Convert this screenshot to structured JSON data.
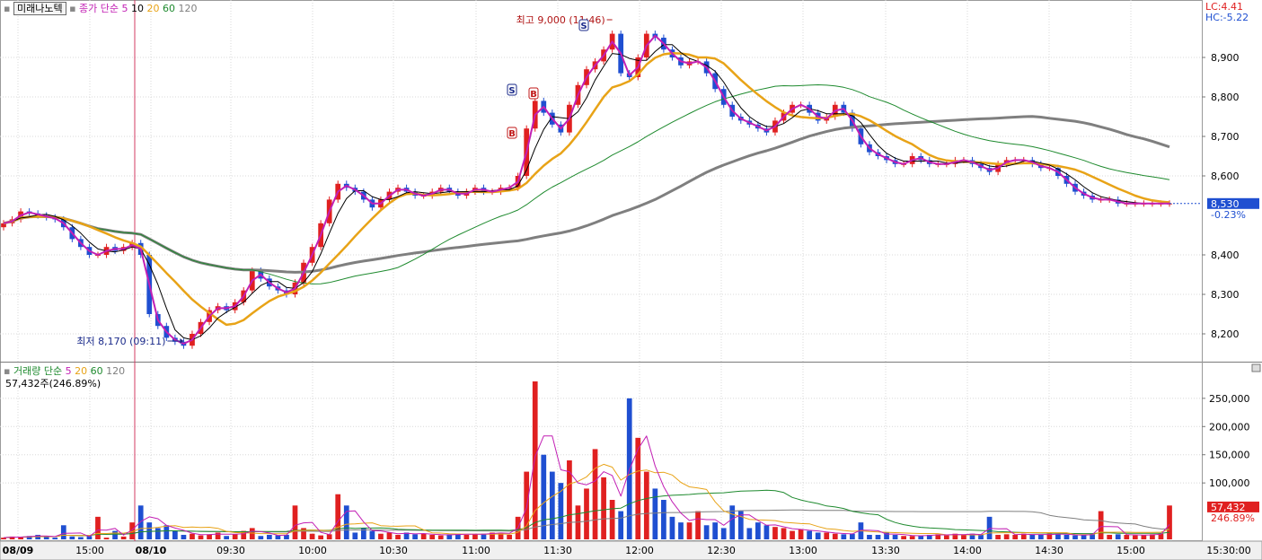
{
  "title": "미래나노텍",
  "price_legend": {
    "label": "종가 단순",
    "periods": [
      "5",
      "10",
      "20",
      "60",
      "120"
    ]
  },
  "lc_hc": {
    "lc": "LC:4.41",
    "hc": "HC:-5.22"
  },
  "current": {
    "price": "8,530",
    "change": "-0.23%"
  },
  "annotations": {
    "high": "최고 9,000 (11:46)",
    "low": "최저 8,170 (09:11)"
  },
  "volume_header": {
    "label": "거래량 단순",
    "periods": [
      "5",
      "20",
      "60",
      "120"
    ],
    "current": "57,432주(246.89%)"
  },
  "volume_current": {
    "value": "57,432",
    "pct": "246.89%"
  },
  "signals": [
    "S",
    "S",
    "B",
    "B"
  ],
  "colors": {
    "ma5": "#c21fb4",
    "ma10": "#000000",
    "ma20": "#e8a317",
    "ma60": "#1e8a2e",
    "ma120": "#7f7f7f",
    "up": "#e02020",
    "down": "#1f4fd1",
    "price_tag": "#1f4fd1",
    "vol_tag": "#e02020"
  },
  "chart_data": {
    "type": "candlestick",
    "price_axis": {
      "ticks": [
        "8,900",
        "8,800",
        "8,700",
        "8,600",
        "8,400",
        "8,300",
        "8,200"
      ],
      "ylim": [
        8150,
        9000
      ]
    },
    "volume_axis": {
      "ticks": [
        "250,000",
        "200,000",
        "150,000",
        "100,000"
      ],
      "ylim": [
        0,
        290000
      ]
    },
    "x_ticks": [
      "08/09",
      "15:00",
      "08/10",
      "09:30",
      "10:00",
      "10:30",
      "11:00",
      "11:30",
      "12:00",
      "12:30",
      "13:00",
      "13:30",
      "14:00",
      "14:30",
      "15:00",
      "15:30:00"
    ],
    "close": [
      8480,
      8490,
      8510,
      8505,
      8500,
      8495,
      8490,
      8470,
      8440,
      8420,
      8400,
      8400,
      8420,
      8410,
      8420,
      8430,
      8400,
      8250,
      8220,
      8190,
      8180,
      8170,
      8200,
      8230,
      8260,
      8270,
      8260,
      8280,
      8310,
      8360,
      8340,
      8320,
      8310,
      8300,
      8330,
      8380,
      8420,
      8480,
      8540,
      8580,
      8570,
      8560,
      8540,
      8520,
      8540,
      8560,
      8570,
      8560,
      8550,
      8550,
      8560,
      8570,
      8560,
      8550,
      8560,
      8570,
      8560,
      8560,
      8570,
      8570,
      8600,
      8720,
      8790,
      8760,
      8730,
      8710,
      8780,
      8830,
      8870,
      8890,
      8920,
      8960,
      8860,
      8850,
      8900,
      8960,
      8950,
      8920,
      8900,
      8880,
      8890,
      8890,
      8860,
      8820,
      8780,
      8750,
      8740,
      8730,
      8720,
      8710,
      8740,
      8760,
      8780,
      8780,
      8760,
      8740,
      8750,
      8780,
      8760,
      8720,
      8680,
      8660,
      8650,
      8640,
      8630,
      8630,
      8650,
      8640,
      8630,
      8630,
      8630,
      8640,
      8640,
      8630,
      8620,
      8610,
      8630,
      8640,
      8640,
      8640,
      8630,
      8620,
      8620,
      8600,
      8580,
      8560,
      8550,
      8540,
      8540,
      8540,
      8530,
      8530,
      8530,
      8530,
      8530,
      8530,
      8530
    ],
    "volume": [
      3000,
      5000,
      4000,
      6000,
      8000,
      4000,
      3000,
      25000,
      5000,
      4000,
      6000,
      40000,
      3000,
      15000,
      5000,
      30000,
      60000,
      30000,
      20000,
      25000,
      15000,
      8000,
      10000,
      7000,
      9000,
      12000,
      6000,
      9000,
      15000,
      20000,
      6000,
      8000,
      7000,
      8000,
      60000,
      20000,
      10000,
      7000,
      9000,
      80000,
      60000,
      12000,
      20000,
      15000,
      10000,
      12000,
      8000,
      12000,
      9000,
      10000,
      8000,
      7000,
      9000,
      10000,
      8000,
      9000,
      10000,
      12000,
      12000,
      8000,
      40000,
      120000,
      280000,
      150000,
      120000,
      100000,
      140000,
      60000,
      90000,
      160000,
      110000,
      70000,
      50000,
      250000,
      180000,
      120000,
      90000,
      70000,
      40000,
      30000,
      30000,
      50000,
      25000,
      30000,
      20000,
      60000,
      50000,
      20000,
      30000,
      25000,
      22000,
      20000,
      15000,
      18000,
      15000,
      12000,
      12000,
      10000,
      9000,
      10000,
      30000,
      8000,
      8000,
      12000,
      8000,
      6000,
      6000,
      7000,
      8000,
      9000,
      7000,
      10000,
      8000,
      10000,
      8000,
      40000,
      8000,
      9000,
      8000,
      10000,
      8000,
      8000,
      10000,
      9000,
      8000,
      7000,
      8000,
      10000,
      50000,
      8000,
      9000,
      8000,
      7000,
      8000,
      9000,
      10000,
      60000
    ]
  }
}
